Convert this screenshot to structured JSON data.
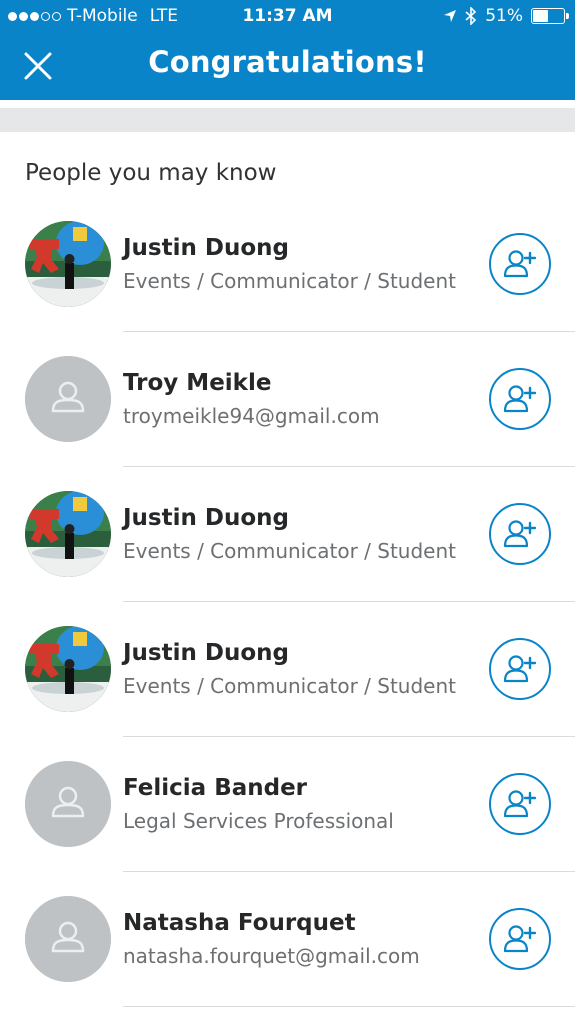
{
  "status_bar": {
    "carrier": "T-Mobile",
    "network": "LTE",
    "time": "11:37 AM",
    "battery": "51%",
    "battery_level": 0.51,
    "signal_bars_filled": 3,
    "signal_bars_total": 5
  },
  "header": {
    "title": "Congratulations!",
    "close_icon": "close-icon"
  },
  "section": {
    "title": "People you may know"
  },
  "people": [
    {
      "name": "Justin Duong",
      "headline": "Events / Communicator / Student",
      "avatar": "photo"
    },
    {
      "name": "Troy Meikle",
      "headline": "troymeikle94@gmail.com",
      "avatar": "placeholder"
    },
    {
      "name": "Justin Duong",
      "headline": "Events / Communicator / Student",
      "avatar": "photo"
    },
    {
      "name": "Justin Duong",
      "headline": "Events / Communicator / Student",
      "avatar": "photo"
    },
    {
      "name": "Felicia Bander",
      "headline": "Legal Services Professional",
      "avatar": "placeholder"
    },
    {
      "name": "Natasha Fourquet",
      "headline": "natasha.fourquet@gmail.com",
      "avatar": "placeholder"
    }
  ],
  "colors": {
    "brand": "#0a84c9",
    "divider": "#d9dbdd",
    "placeholder_avatar": "#bfc2c5"
  }
}
